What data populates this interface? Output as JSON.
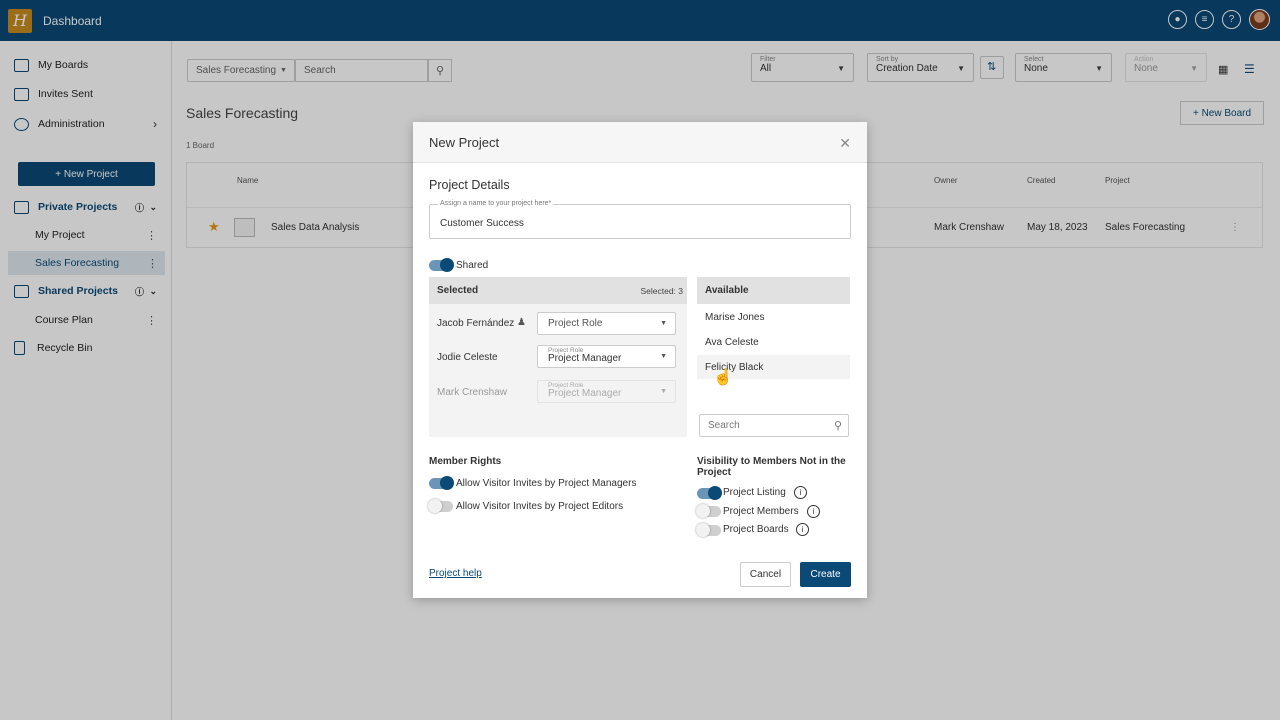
{
  "app": {
    "title": "Dashboard",
    "logo_letter": "H"
  },
  "header_icons": [
    "bell-icon",
    "list-icon",
    "help-icon",
    "avatar"
  ],
  "sidebar": {
    "items": [
      {
        "label": "My Boards",
        "icon": "boards-icon"
      },
      {
        "label": "Invites Sent",
        "icon": "invites-icon"
      },
      {
        "label": "Administration",
        "icon": "admin-icon"
      }
    ],
    "new_project_label": "+ New Project",
    "private_projects_label": "Private Projects",
    "private_projects": [
      "My Project",
      "Sales Forecasting"
    ],
    "shared_projects_label": "Shared Projects",
    "shared_projects": [
      "Course Plan"
    ],
    "recycle_bin_label": "Recycle Bin"
  },
  "toolbar": {
    "board_select": "Sales Forecasting",
    "search_placeholder": "Search",
    "filter_label": "Filter",
    "filter_value": "All",
    "sort_label": "Sort by",
    "sort_value": "Creation Date",
    "select_label": "Select",
    "select_value": "None",
    "action_label": "Action",
    "action_value": "None"
  },
  "main": {
    "title": "Sales Forecasting",
    "new_board_label": "+  New Board",
    "board_count": "1 Board",
    "columns": {
      "name": "Name",
      "owner": "Owner",
      "created": "Created",
      "project": "Project"
    },
    "rows": [
      {
        "name": "Sales Data Analysis",
        "owner": "Mark Crenshaw",
        "created": "May 18, 2023",
        "project": "Sales Forecasting"
      }
    ]
  },
  "modal": {
    "title": "New Project",
    "section_title": "Project Details",
    "name_float_label": "Assign a name to your project here*",
    "name_value": "Customer Success",
    "shared_label": "Shared",
    "selected_header": "Selected",
    "selected_count": "Selected: 3",
    "members": [
      {
        "name": "Jacob Fernández",
        "role_label": "",
        "role": "Project Role"
      },
      {
        "name": "Jodie Celeste",
        "role_label": "Project Role",
        "role": "Project Manager"
      },
      {
        "name": "Mark Crenshaw",
        "role_label": "Project Role",
        "role": "Project Manager"
      }
    ],
    "available_header": "Available",
    "available": [
      "Marise Jones",
      "Ava Celeste",
      "Felicity Black"
    ],
    "available_search_placeholder": "Search",
    "member_rights_title": "Member Rights",
    "rights": [
      {
        "label": "Allow Visitor Invites by Project Managers",
        "on": true
      },
      {
        "label": "Allow Visitor Invites by Project Editors",
        "on": false
      }
    ],
    "visibility_title": "Visibility to Members Not in the Project",
    "visibility": [
      {
        "label": "Project Listing",
        "on": true
      },
      {
        "label": "Project Members",
        "on": false
      },
      {
        "label": "Project Boards",
        "on": false
      }
    ],
    "help_link": "Project help",
    "cancel_label": "Cancel",
    "create_label": "Create"
  },
  "colors": {
    "brand": "#0b4a76",
    "logo": "#c88c1e",
    "star": "#e49a1a"
  }
}
